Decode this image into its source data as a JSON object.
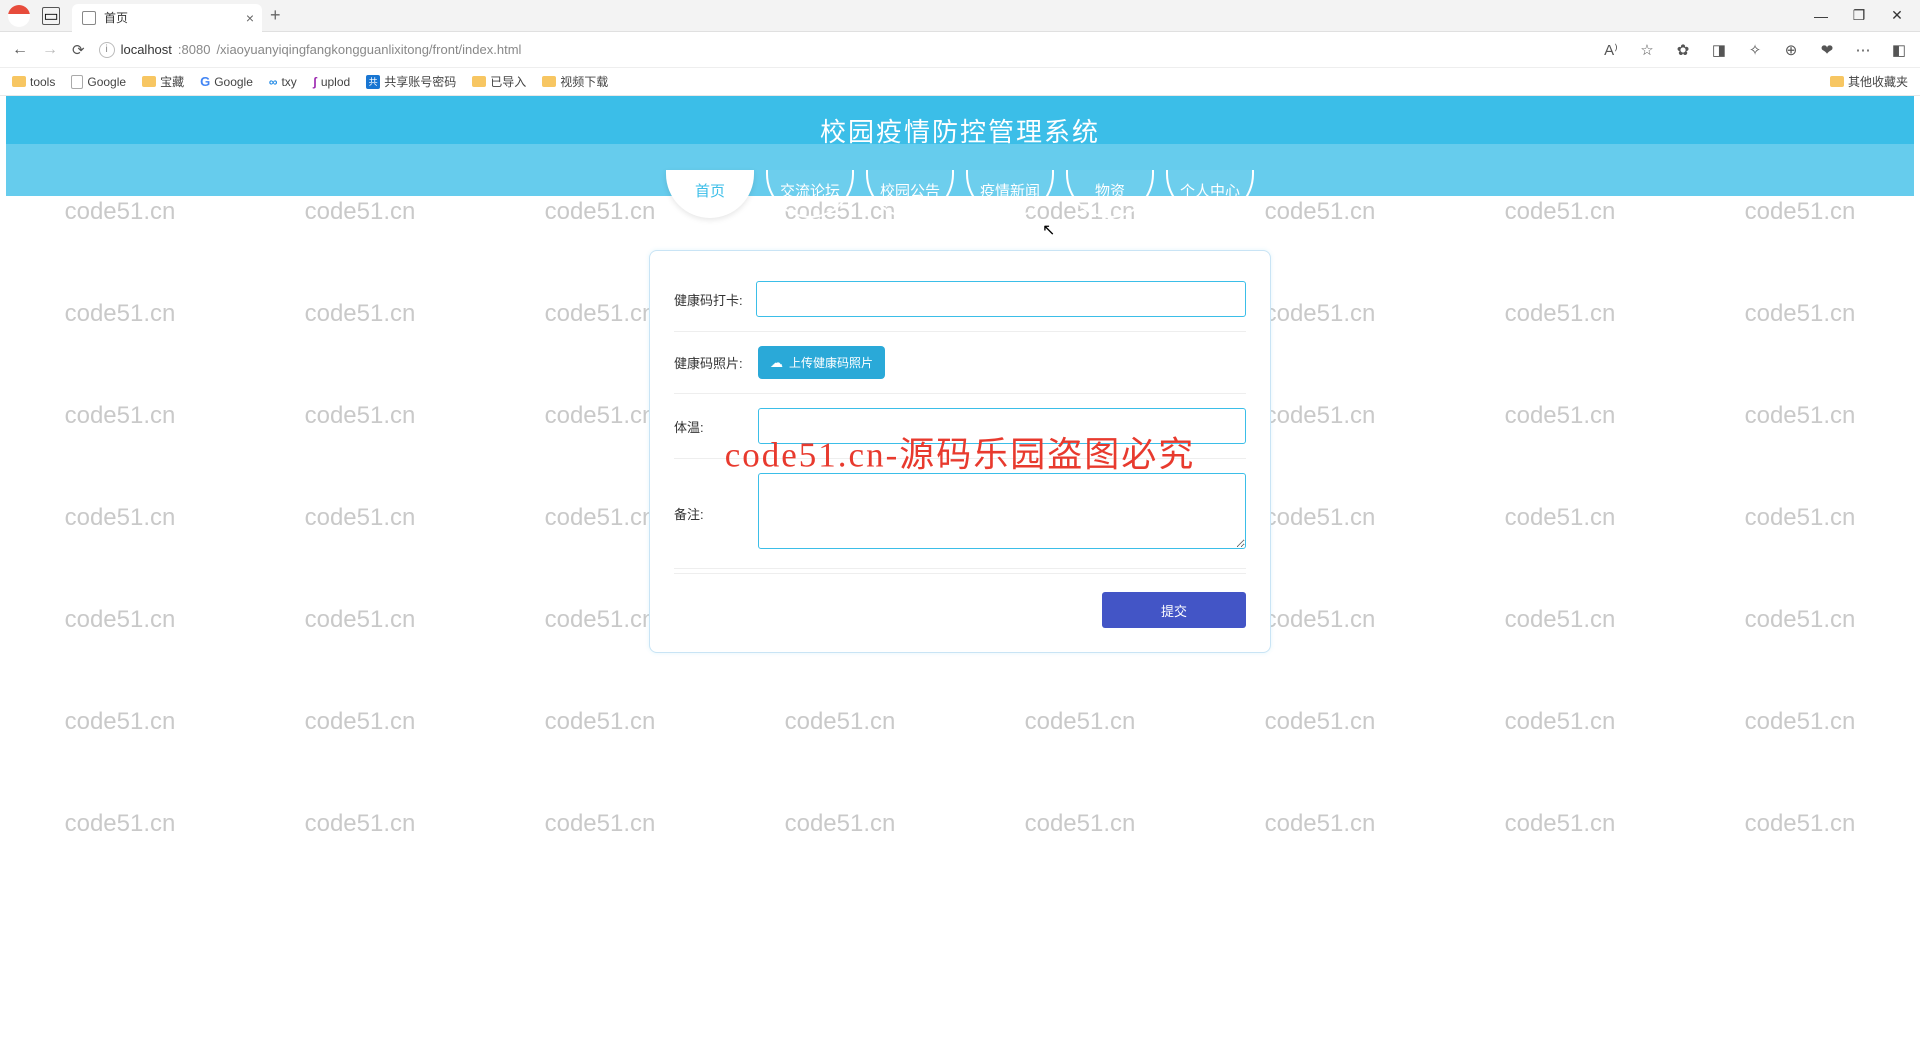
{
  "browser": {
    "tab_title": "首页",
    "url_host": "localhost",
    "url_port": ":8080",
    "url_path": "/xiaoyuanyiqingfangkongguanlixitong/front/index.html",
    "bookmarks": [
      "tools",
      "Google",
      "宝藏",
      "Google",
      "txy",
      "uplod",
      "共享账号密码",
      "已导入",
      "视频下载"
    ],
    "bookmarks_right": "其他收藏夹"
  },
  "page": {
    "site_title": "校园疫情防控管理系统",
    "nav": [
      "首页",
      "交流论坛",
      "校园公告",
      "疫情新闻",
      "物资",
      "个人中心"
    ],
    "active_nav_index": 0
  },
  "form": {
    "field1_label": "健康码打卡:",
    "field1_value": "",
    "field2_label": "健康码照片:",
    "upload_btn": "上传健康码照片",
    "field3_label": "体温:",
    "field3_value": "",
    "field4_label": "备注:",
    "field4_value": "",
    "submit": "提交"
  },
  "watermark": {
    "text": "code51.cn",
    "big_text": "code51.cn-源码乐园盗图必究"
  }
}
